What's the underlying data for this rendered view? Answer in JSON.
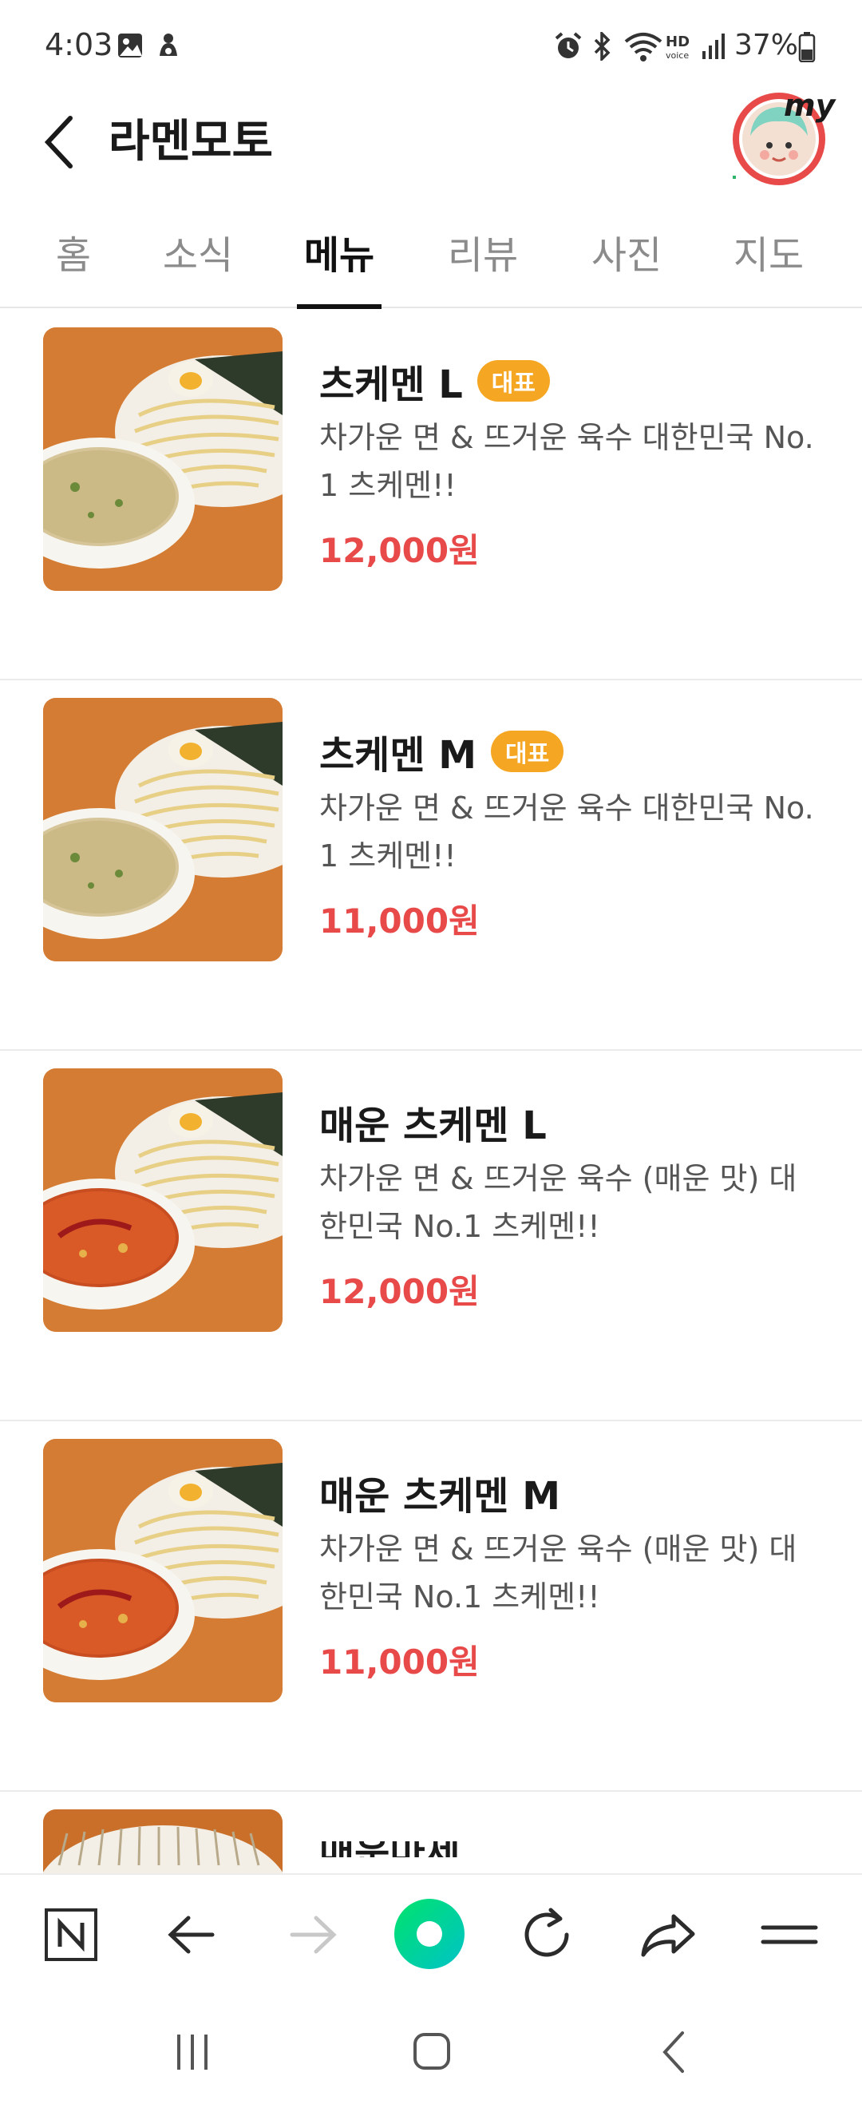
{
  "status_bar": {
    "time": "4:03",
    "battery": "37%",
    "icons": [
      "gallery-icon",
      "notification-icon",
      "alarm-icon",
      "bluetooth-icon",
      "wifi-icon",
      "hd-voice-icon",
      "signal-icon",
      "battery-icon"
    ]
  },
  "header": {
    "title": "라멘모토",
    "avatar_label": "my"
  },
  "tabs": [
    {
      "label": "홈",
      "active": false
    },
    {
      "label": "소식",
      "active": false
    },
    {
      "label": "메뉴",
      "active": true
    },
    {
      "label": "리뷰",
      "active": false
    },
    {
      "label": "사진",
      "active": false
    },
    {
      "label": "지도",
      "active": false
    }
  ],
  "menu_items": [
    {
      "name": "츠케멘 L",
      "badge": "대표",
      "description": "차가운 면 & 뜨거운 육수 대한민국 No. 1 츠케멘!!",
      "price": "12,000원",
      "broth": "mild"
    },
    {
      "name": "츠케멘 M",
      "badge": "대표",
      "description": "차가운 면 & 뜨거운 육수 대한민국 No. 1 츠케멘!!",
      "price": "11,000원",
      "broth": "mild"
    },
    {
      "name": "매운 츠케멘 L",
      "badge": "",
      "description": "차가운 면 & 뜨거운 육수 (매운 맛) 대한민국 No.1 츠케멘!!",
      "price": "12,000원",
      "broth": "spicy"
    },
    {
      "name": "매운 츠케멘 M",
      "badge": "",
      "description": "차가운 면 & 뜨거운 육수 (매운 맛) 대한민국 No.1 츠케멘!!",
      "price": "11,000원",
      "broth": "spicy"
    }
  ],
  "colors": {
    "price": "#e84a4a",
    "badge": "#f5a623",
    "naver_green": "#00de5a"
  }
}
